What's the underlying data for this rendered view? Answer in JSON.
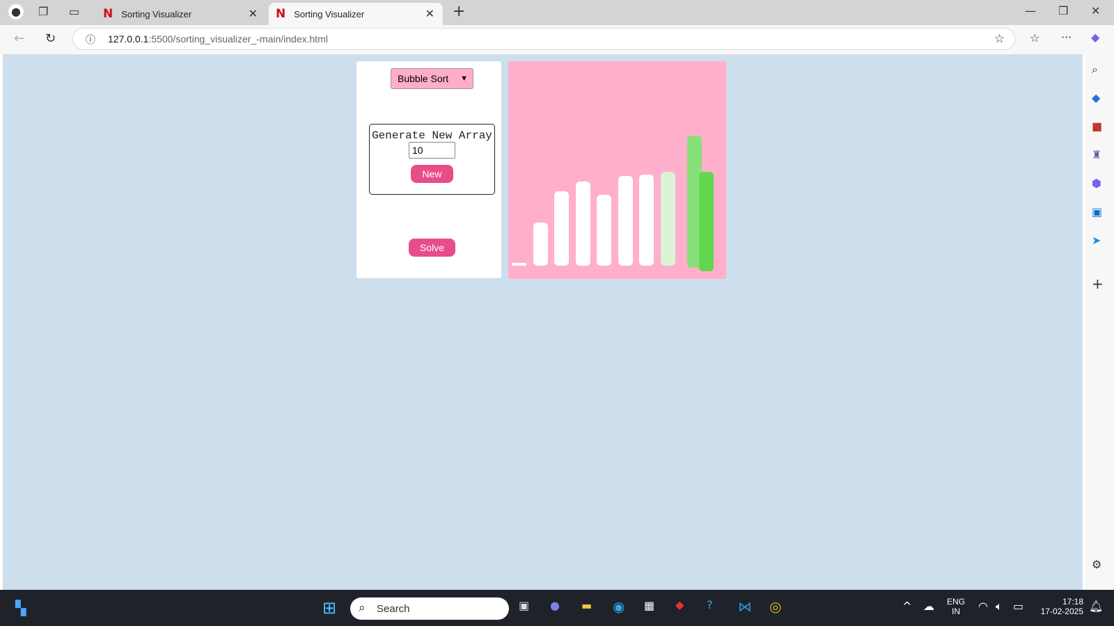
{
  "browser": {
    "tabs": [
      {
        "title": "Sorting Visualizer",
        "active": false
      },
      {
        "title": "Sorting Visualizer",
        "active": true
      }
    ],
    "url_host": "127.0.0.1",
    "url_path": ":5500/sorting_visualizer_-main/index.html"
  },
  "controls": {
    "algorithm": "Bubble Sort",
    "generate_label": "Generate New Array",
    "array_size": "10",
    "new_label": "New",
    "solve_label": "Solve"
  },
  "visualizer": {
    "background": "#ffafcc",
    "bars": [
      {
        "value": 4,
        "state": "default"
      },
      {
        "value": 62,
        "state": "default"
      },
      {
        "value": 107,
        "state": "default"
      },
      {
        "value": 121,
        "state": "default"
      },
      {
        "value": 102,
        "state": "default"
      },
      {
        "value": 129,
        "state": "default"
      },
      {
        "value": 131,
        "state": "default"
      },
      {
        "value": 135,
        "state": "sorted-light"
      },
      {
        "value": 190,
        "state": "swapping"
      },
      {
        "value": 143,
        "state": "swapping-active"
      }
    ],
    "colors": {
      "default": "#ffffff",
      "sorted-light": "#d9f3d4",
      "swapping": "#88e07a",
      "swapping-active": "#63d64f"
    }
  },
  "taskbar": {
    "search_placeholder": "Search",
    "lang": "ENG",
    "region": "IN",
    "time": "17:18",
    "date": "17-02-2025"
  }
}
